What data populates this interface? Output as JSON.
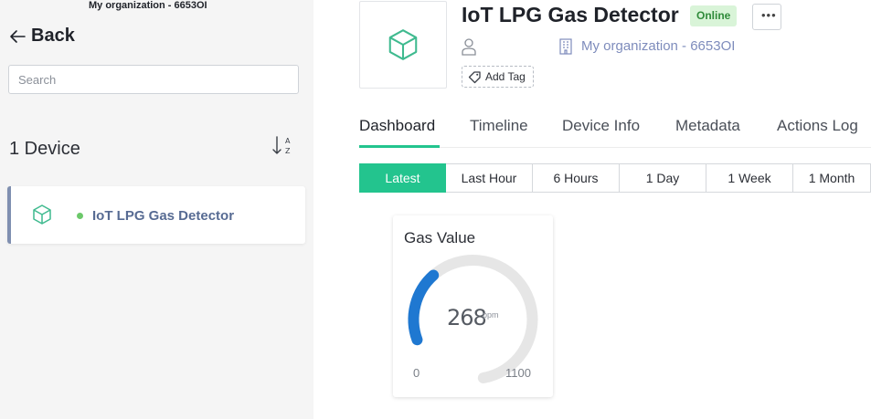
{
  "sidebar": {
    "org_header": "My organization - 6653OI",
    "back_label": "Back",
    "search_placeholder": "Search",
    "device_count": "1 Device",
    "sort_icon": "sort-az-icon",
    "devices": [
      {
        "name": "IoT LPG Gas Detector",
        "status": "online",
        "icon": "cube-icon"
      }
    ]
  },
  "device": {
    "title": "IoT LPG Gas Detector",
    "status": "Online",
    "more_label": "•••",
    "owner_icon": "user-icon",
    "organization": "My organization - 6653OI",
    "add_tag_label": "Add Tag"
  },
  "tabs": [
    {
      "label": "Dashboard",
      "active": true
    },
    {
      "label": "Timeline",
      "active": false
    },
    {
      "label": "Device Info",
      "active": false
    },
    {
      "label": "Metadata",
      "active": false
    },
    {
      "label": "Actions Log",
      "active": false
    }
  ],
  "time_ranges": [
    {
      "label": "Latest",
      "active": true
    },
    {
      "label": "Last Hour",
      "active": false
    },
    {
      "label": "6 Hours",
      "active": false
    },
    {
      "label": "1 Day",
      "active": false
    },
    {
      "label": "1 Week",
      "active": false
    },
    {
      "label": "1 Month",
      "active": false
    }
  ],
  "widget": {
    "title": "Gas Value",
    "value": 268,
    "value_label": "268",
    "unit": "ppm",
    "min": 0,
    "max": 1100,
    "min_label": "0",
    "max_label": "1100"
  },
  "colors": {
    "accent": "#23c48e",
    "gauge_fill": "#1f78d1",
    "gauge_track": "#e6e6e6",
    "online_dot": "#6cc86a",
    "link": "#7e8cbc"
  }
}
